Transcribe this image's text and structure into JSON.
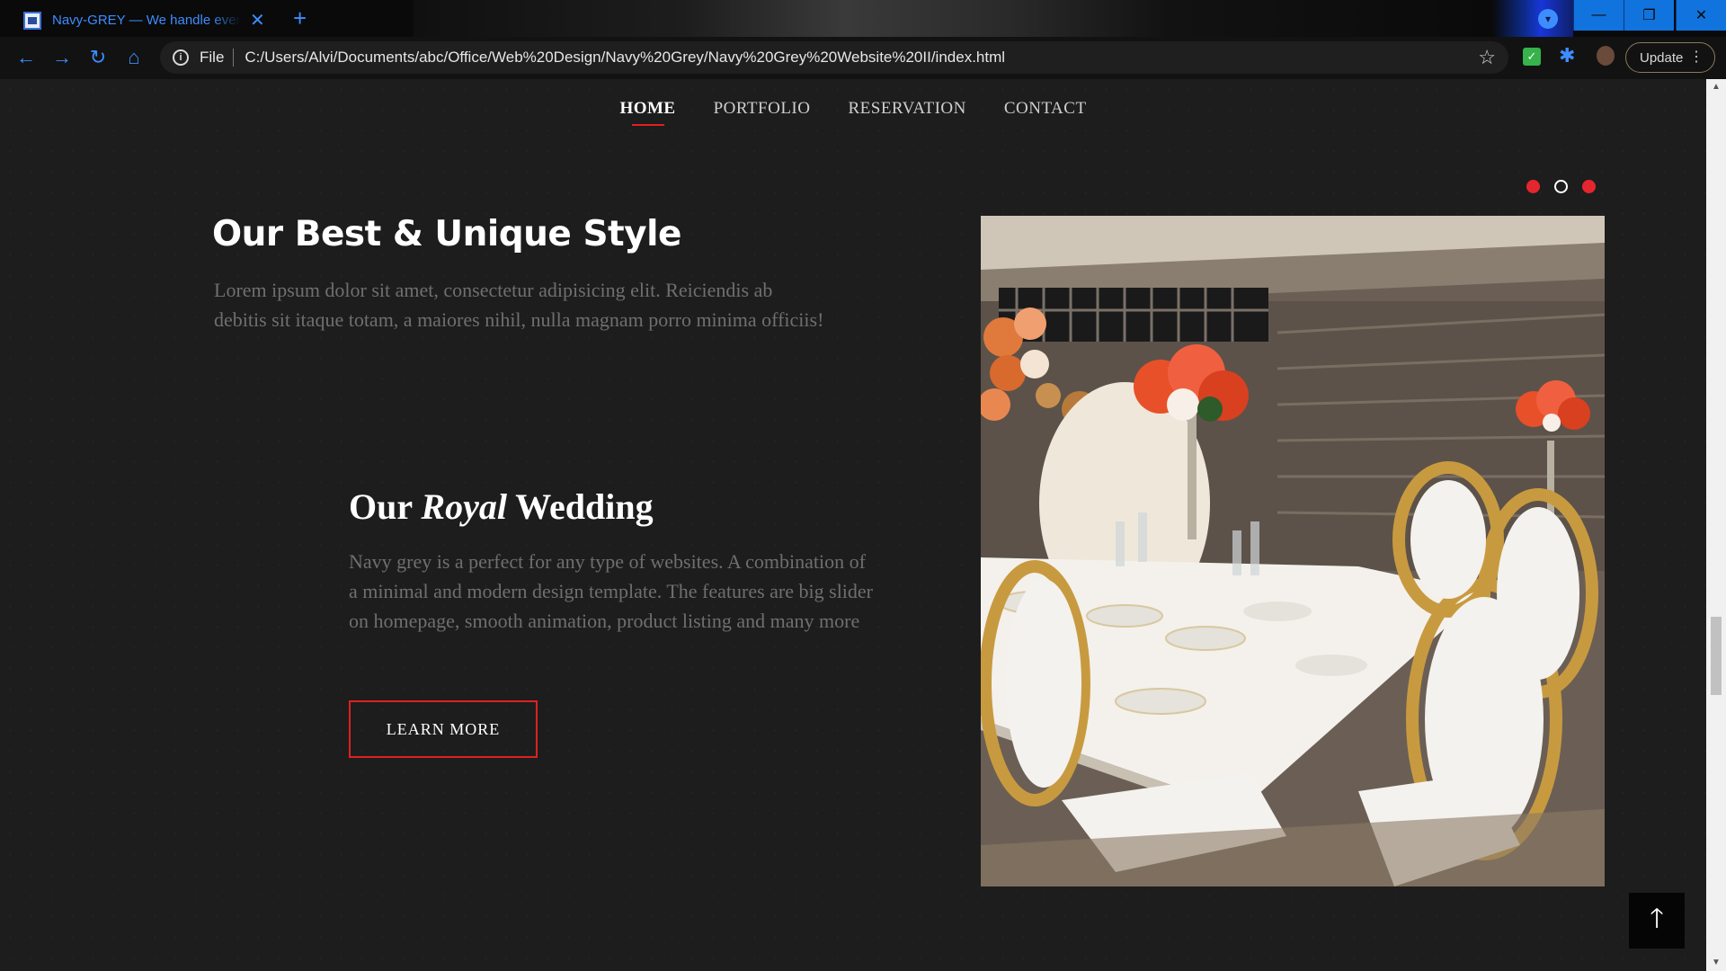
{
  "browser": {
    "tab_title": "Navy-GREY — We handle event f",
    "url_scheme": "File",
    "url": "C:/Users/Alvi/Documents/abc/Office/Web%20Design/Navy%20Grey/Navy%20Grey%20Website%20II/index.html",
    "update_label": "Update",
    "accent_color": "#3d8dff",
    "window_button_color": "#1173dd"
  },
  "nav": {
    "items": [
      {
        "label": "HOME",
        "active": true
      },
      {
        "label": "PORTFOLIO",
        "active": false
      },
      {
        "label": "RESERVATION",
        "active": false
      },
      {
        "label": "CONTACT",
        "active": false
      }
    ]
  },
  "slider": {
    "dots_count": 3,
    "current_dot": 2
  },
  "hero": {
    "title": "Our Best & Unique Style",
    "text": "Lorem ipsum dolor sit amet, consectetur adipisicing elit. Reiciendis ab debitis sit itaque totam, a maiores nihil, nulla magnam porro minima officiis!"
  },
  "feature": {
    "title_before": "Our",
    "title_emphasis": "Royal",
    "title_after": "Wedding",
    "text": "Navy grey is a perfect for any type of websites. A combination of a minimal and modern design template. The features are big slider on homepage, smooth animation, product listing and many more",
    "button_label": "LEARN MORE"
  },
  "colors": {
    "accent_red": "#e02020",
    "background": "#1d1d1d"
  }
}
